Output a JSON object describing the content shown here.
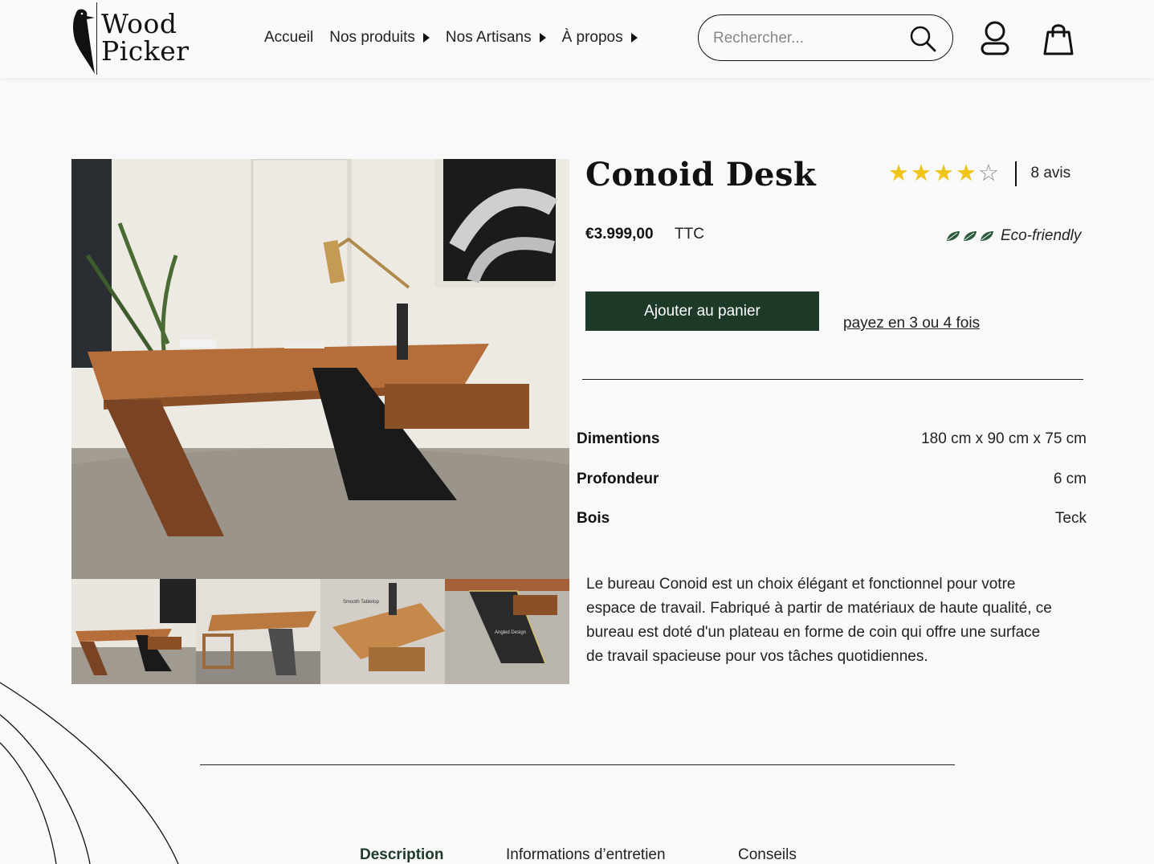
{
  "header": {
    "logo_line1": "Wood",
    "logo_line2": "Picker",
    "nav": [
      {
        "label": "Accueil",
        "has_dropdown": false
      },
      {
        "label": "Nos produits",
        "has_dropdown": true
      },
      {
        "label": "Nos Artisans",
        "has_dropdown": true
      },
      {
        "label": "À propos",
        "has_dropdown": true
      }
    ],
    "search_placeholder": "Rechercher...",
    "icons": [
      "search-icon",
      "user-icon",
      "shopping-bag-icon"
    ]
  },
  "product": {
    "title": "Conoid Desk",
    "rating": {
      "value": 4,
      "max": 5
    },
    "reviews": "8 avis",
    "price": "€3.999,00",
    "tax_label": "TTC",
    "eco_label": "Eco-friendly",
    "eco_leaves": 3,
    "add_to_cart": "Ajouter au panier",
    "installments": "payez en 3 ou 4 fois",
    "specs": [
      {
        "label": "Dimentions",
        "value": "180 cm x 90 cm x 75 cm"
      },
      {
        "label": "Profondeur",
        "value": "6 cm"
      },
      {
        "label": "Bois",
        "value": "Teck"
      }
    ],
    "description": "Le bureau Conoid est un choix élégant et fonctionnel pour votre espace de travail. Fabriqué à partir de matériaux de haute qualité, ce bureau est doté d'un plateau en forme de coin qui offre une surface de travail spacieuse pour vos tâches quotidiennes.",
    "thumbnail_captions": [
      "Smooth Tabletop",
      "Angled Design"
    ]
  },
  "tabs": [
    {
      "label": "Description",
      "active": true
    },
    {
      "label": "Informations d’entretien",
      "active": false
    },
    {
      "label": "Conseils",
      "active": false
    }
  ],
  "colors": {
    "accent": "#1d3a28",
    "star": "#f0c419",
    "background": "#f9f9f9"
  }
}
